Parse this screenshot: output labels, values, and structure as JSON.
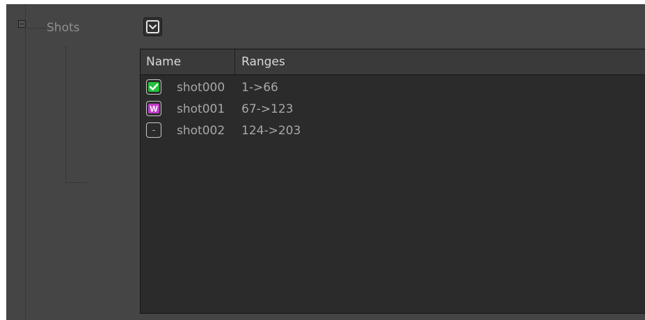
{
  "tree": {
    "node_label": "Shots"
  },
  "table": {
    "columns": [
      "Name",
      "Ranges"
    ],
    "rows": [
      {
        "status": "approved",
        "status_glyph": "✓",
        "status_color": "#23c23a",
        "name": "shot000",
        "range": "1->66"
      },
      {
        "status": "work",
        "status_glyph": "W",
        "status_color": "#c23ac9",
        "name": "shot001",
        "range": "67->123"
      },
      {
        "status": "none",
        "status_glyph": "-",
        "status_color": "#c9c9c9",
        "name": "shot002",
        "range": "124->203"
      }
    ]
  }
}
